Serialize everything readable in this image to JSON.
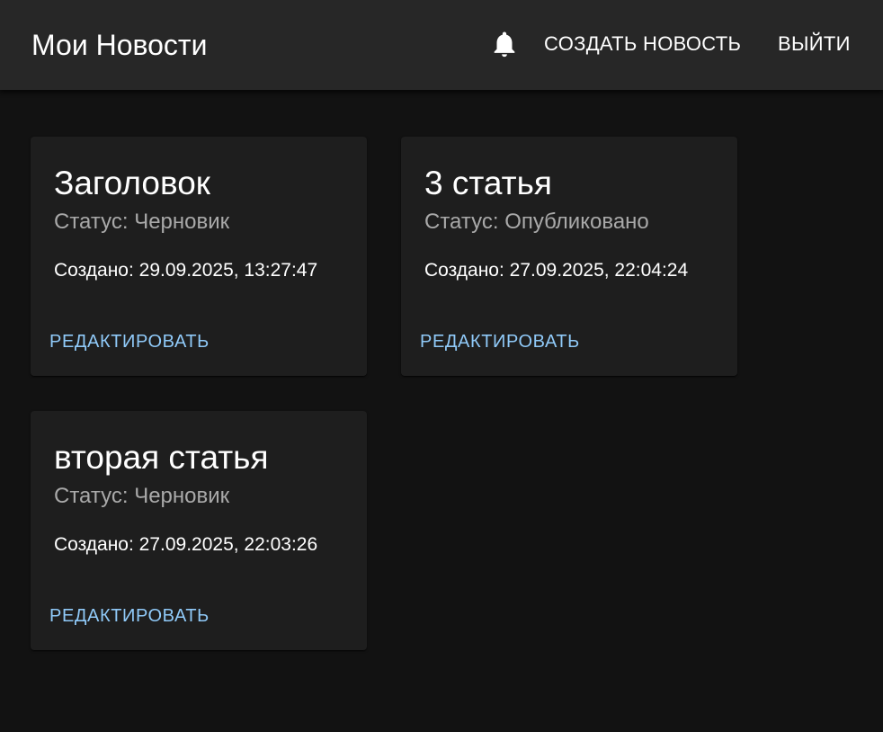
{
  "header": {
    "title": "Мои Новости",
    "notifications_icon": "bell-icon",
    "create_label": "СОЗДАТЬ НОВОСТЬ",
    "logout_label": "ВЫЙТИ"
  },
  "colors": {
    "background": "#121212",
    "appbar": "#272727",
    "card": "#1e1e1e",
    "status_text": "#a9a9a9",
    "action_text": "#90caf9"
  },
  "news": [
    {
      "title": "Заголовок",
      "status": "Статус: Черновик",
      "created": "Создано: 29.09.2025, 13:27:47",
      "action": "РЕДАКТИРОВАТЬ"
    },
    {
      "title": "3 статья",
      "status": "Статус: Опубликовано",
      "created": "Создано: 27.09.2025, 22:04:24",
      "action": "РЕДАКТИРОВАТЬ"
    },
    {
      "title": "вторая статья",
      "status": "Статус: Черновик",
      "created": "Создано: 27.09.2025, 22:03:26",
      "action": "РЕДАКТИРОВАТЬ"
    }
  ]
}
